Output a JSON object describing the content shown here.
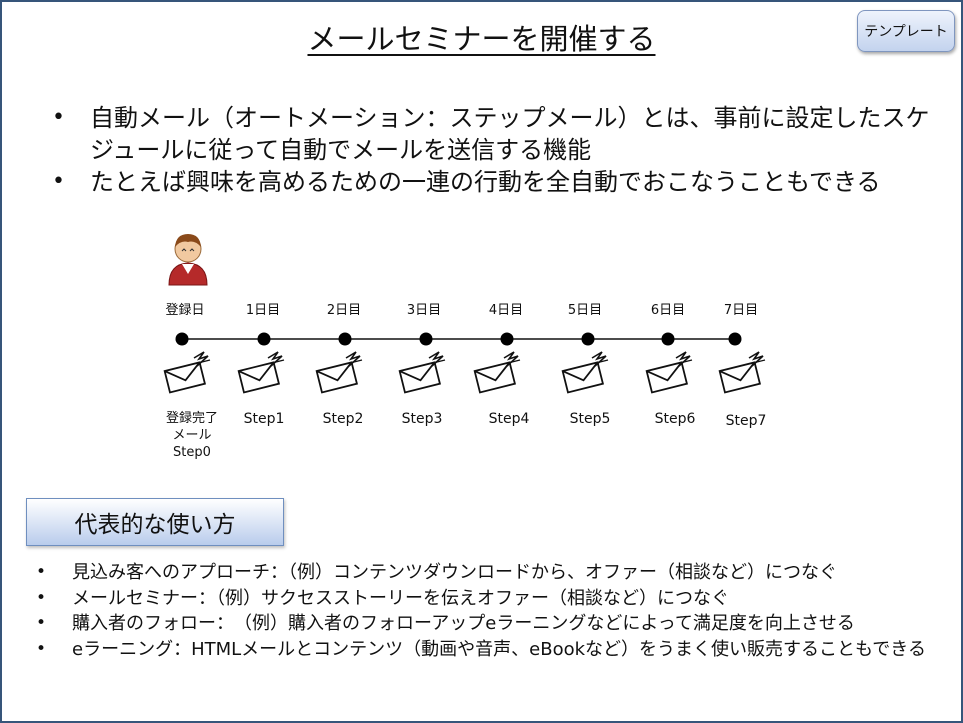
{
  "title": "メールセミナーを開催する",
  "template_button": "テンプレート",
  "main_bullets": [
    "自動メール（オートメーション：ステップメール）とは、事前に設定したスケジュールに従って自動でメールを送信する機能",
    "たとえば興味を高めるための一連の行動を全自動でおこなうこともできる"
  ],
  "timeline": {
    "days": [
      "登録日",
      "1日目",
      "2日目",
      "3日目",
      "4日目",
      "5日目",
      "6日目",
      "7日目"
    ],
    "steps": [
      "登録完了\nメール\nStep0",
      "Step1",
      "Step2",
      "Step3",
      "Step4",
      "Step5",
      "Step6",
      "Step7"
    ],
    "icons": [
      "person-icon",
      "envelope-icon"
    ]
  },
  "usage": {
    "heading": "代表的な使い方",
    "items": [
      "見込み客へのアプローチ：（例）コンテンツダウンロードから、オファー（相談など）につなぐ",
      "メールセミナー：（例）サクセスストーリーを伝えオファー（相談など）につなぐ",
      "購入者のフォロー：　（例）購入者のフォローアップeラーニングなどによって満足度を向上させる",
      "eラーニング：HTMLメールとコンテンツ（動画や音声、eBookなど）をうまく使い販売することもできる"
    ]
  }
}
